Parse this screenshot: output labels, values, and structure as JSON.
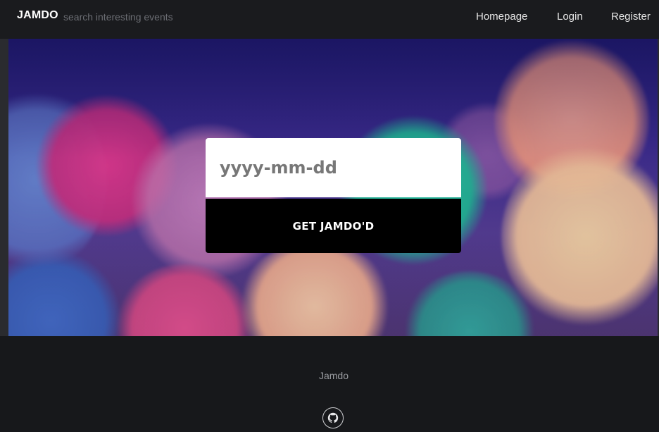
{
  "navbar": {
    "brand": "JAMDO",
    "tagline": "search interesting events",
    "links": [
      {
        "label": "Homepage"
      },
      {
        "label": "Login"
      },
      {
        "label": "Register"
      }
    ]
  },
  "search_form": {
    "date_placeholder": "yyyy-mm-dd",
    "date_value": "",
    "submit_label": "GET JAMDO'D"
  },
  "footer": {
    "name": "Jamdo",
    "social_icon": "github-icon"
  },
  "colors": {
    "navbar_bg": "#1a1b1e",
    "page_bg": "#17181b",
    "button_bg": "#000000",
    "input_bg": "#ffffff"
  }
}
